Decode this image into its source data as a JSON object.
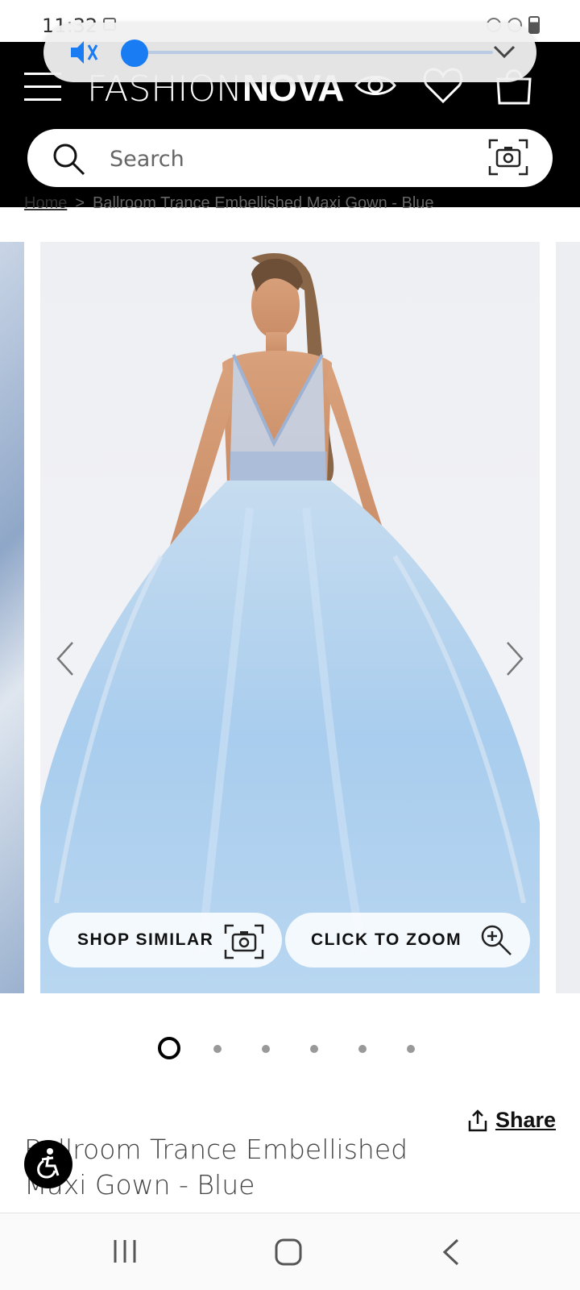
{
  "status_bar": {
    "time": "11:32"
  },
  "volume_overlay": {
    "icons": [
      "mute-icon",
      "chevron-down-icon"
    ],
    "level": 0.0,
    "accent_color": "#1a7cf3"
  },
  "header": {
    "logo_thin": "FASHION",
    "logo_bold": "NOVA",
    "icons": [
      "menu-icon",
      "eye-icon",
      "heart-icon",
      "bag-icon"
    ]
  },
  "search": {
    "placeholder": "Search",
    "icons": [
      "search-icon",
      "camera-icon"
    ]
  },
  "breadcrumb": {
    "home": "Home",
    "separator": ">",
    "current": "Ballroom Trance Embellished Maxi Gown - Blue"
  },
  "carousel": {
    "slide_count": 6,
    "active_index": 0,
    "shop_similar_label": "SHOP SIMILAR",
    "click_to_zoom_label": "CLICK TO ZOOM",
    "icons": [
      "chevron-left-icon",
      "chevron-right-icon",
      "camera-icon",
      "zoom-in-icon"
    ]
  },
  "product": {
    "share_label": "Share",
    "title": "Ballroom Trance Embellished Maxi Gown - Blue"
  },
  "nav_bar": {
    "icons": [
      "recent-apps-icon",
      "home-icon",
      "back-icon"
    ]
  }
}
